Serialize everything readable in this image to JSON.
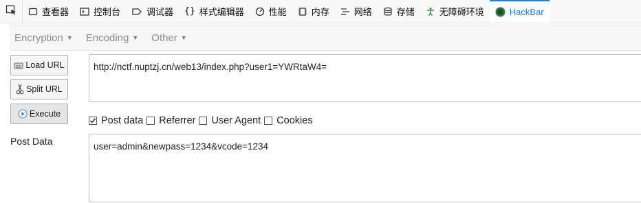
{
  "devtools": {
    "tabs": [
      {
        "label": "查看器",
        "icon": "inspector-icon"
      },
      {
        "label": "控制台",
        "icon": "console-icon"
      },
      {
        "label": "调试器",
        "icon": "debugger-icon"
      },
      {
        "label": "样式编辑器",
        "icon": "style-editor-icon"
      },
      {
        "label": "性能",
        "icon": "performance-icon"
      },
      {
        "label": "内存",
        "icon": "memory-icon"
      },
      {
        "label": "网络",
        "icon": "network-icon"
      },
      {
        "label": "存储",
        "icon": "storage-icon"
      },
      {
        "label": "无障碍环境",
        "icon": "accessibility-icon"
      },
      {
        "label": "HackBar",
        "icon": "hackbar-icon",
        "active": true
      }
    ],
    "active_color": "#0a84ff"
  },
  "hackbar": {
    "menus": [
      "Encryption",
      "Encoding",
      "Other"
    ],
    "buttons": {
      "load_url": "Load URL",
      "split_url": "Split URL",
      "execute": "Execute"
    },
    "url_value": "http://nctf.nuptzj.cn/web13/index.php?user1=YWRtaW4=",
    "options": [
      {
        "label": "Post data",
        "checked": true
      },
      {
        "label": "Referrer",
        "checked": false
      },
      {
        "label": "User Agent",
        "checked": false
      },
      {
        "label": "Cookies",
        "checked": false
      }
    ],
    "post_data_label": "Post Data",
    "post_data_value": "user=admin&newpass=1234&vcode=1234"
  }
}
